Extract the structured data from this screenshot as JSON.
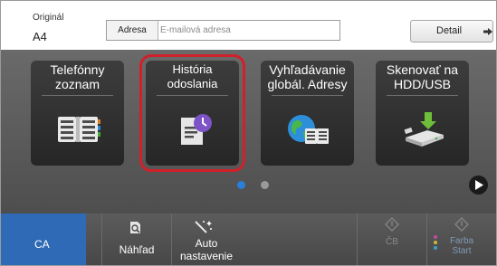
{
  "header": {
    "original_label": "Originál",
    "original_value": "A4",
    "address_label": "Adresa",
    "address_placeholder": "E-mailová adresa",
    "detail_label": "Detail"
  },
  "tiles": [
    {
      "line1": "Telefónny",
      "line2": "zoznam",
      "icon": "address-book-icon"
    },
    {
      "line1": "História odoslania",
      "line2": "",
      "icon": "send-history-icon",
      "selected": true
    },
    {
      "line1": "Vyhľadávanie",
      "line2": "globál. Adresy",
      "icon": "global-address-search-icon"
    },
    {
      "line1": "Skenovať na",
      "line2": "HDD/USB",
      "icon": "scan-to-hdd-usb-icon"
    }
  ],
  "pager": {
    "pages": 2,
    "current": 1
  },
  "bottom": {
    "ca_label": "CA",
    "preview_label": "Náhľad",
    "auto_line1": "Auto",
    "auto_line2": "nastavenie",
    "bw_label": "ČB",
    "color_line1": "Farba",
    "color_line2": "Start"
  },
  "colors": {
    "accent_blue": "#2e6ab5",
    "selection_red": "#d0202a",
    "tile_background": "#2f2f2f"
  }
}
